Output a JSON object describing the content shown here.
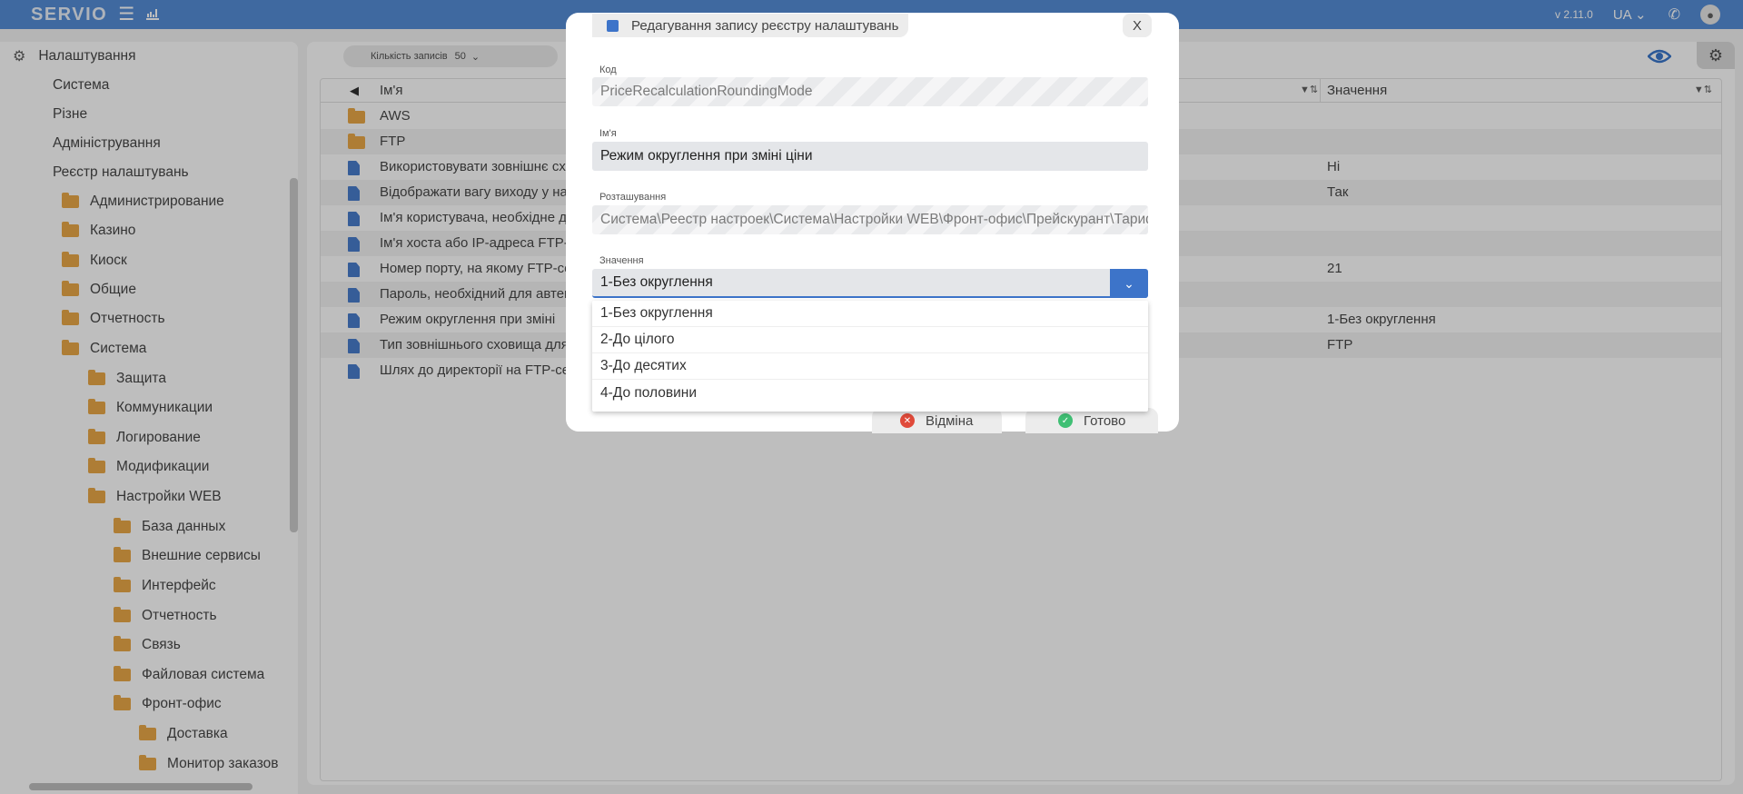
{
  "app": {
    "brand": "SERVIO",
    "version": "v 2.11.0",
    "language": "UA"
  },
  "sidebar": {
    "items": [
      {
        "label": "Налаштування",
        "icon": "gear-icon"
      },
      {
        "label": "Система"
      },
      {
        "label": "Різне"
      },
      {
        "label": "Адміністрування"
      },
      {
        "label": "Реєстр налаштувань"
      },
      {
        "label": "Администрирование",
        "icon": "folder-icon"
      },
      {
        "label": "Казино",
        "icon": "folder-icon"
      },
      {
        "label": "Киоск",
        "icon": "folder-icon"
      },
      {
        "label": "Общие",
        "icon": "folder-icon"
      },
      {
        "label": "Отчетность",
        "icon": "folder-icon"
      },
      {
        "label": "Система",
        "icon": "folder-icon"
      },
      {
        "label": "Защита",
        "icon": "folder-icon"
      },
      {
        "label": "Коммуникации",
        "icon": "folder-icon"
      },
      {
        "label": "Логирование",
        "icon": "folder-icon"
      },
      {
        "label": "Модификации",
        "icon": "folder-icon"
      },
      {
        "label": "Настройки WEB",
        "icon": "folder-icon"
      },
      {
        "label": "База данных",
        "icon": "folder-icon"
      },
      {
        "label": "Внешние сервисы",
        "icon": "folder-icon"
      },
      {
        "label": "Интерфейс",
        "icon": "folder-icon"
      },
      {
        "label": "Отчетность",
        "icon": "folder-icon"
      },
      {
        "label": "Связь",
        "icon": "folder-icon"
      },
      {
        "label": "Файловая система",
        "icon": "folder-icon"
      },
      {
        "label": "Фронт-офис",
        "icon": "folder-icon"
      },
      {
        "label": "Доставка",
        "icon": "folder-icon"
      },
      {
        "label": "Монитор заказов",
        "icon": "folder-icon"
      }
    ]
  },
  "toolbar": {
    "records_label": "Кількість записів",
    "records_value": "50"
  },
  "grid": {
    "columns": {
      "name": "Ім'я",
      "value": "Значення"
    },
    "rows": [
      {
        "name": "AWS",
        "value": "",
        "icon": "folder-icon"
      },
      {
        "name": "FTP",
        "value": "",
        "icon": "folder-icon"
      },
      {
        "name": "Використовувати зовнішнє сх",
        "value": "Ні",
        "icon": "document-icon"
      },
      {
        "name": "Відображати вагу виходу у на",
        "value": "Так",
        "icon": "document-icon"
      },
      {
        "name": "Ім'я користувача, необхідне д",
        "value": "",
        "icon": "document-icon"
      },
      {
        "name": "Ім'я хоста або IP-адреса FTP-с",
        "value": "",
        "icon": "document-icon"
      },
      {
        "name": "Номер порту, на якому FTP-се",
        "value": "21",
        "icon": "document-icon"
      },
      {
        "name": "Пароль, необхідний для автен",
        "value": "",
        "icon": "document-icon"
      },
      {
        "name": "Режим округлення при зміні",
        "value": "1-Без округлення",
        "icon": "document-icon"
      },
      {
        "name": "Тип зовнішнього сховища для",
        "value": "FTP",
        "icon": "document-icon"
      },
      {
        "name": "Шлях до директорії на FTP-се",
        "value": "",
        "icon": "document-icon"
      }
    ]
  },
  "modal": {
    "title": "Редагування запису реєстру налаштувань",
    "close_label": "X",
    "fields": {
      "code": {
        "label": "Код",
        "value": "PriceRecalculationRoundingMode"
      },
      "name": {
        "label": "Ім'я",
        "value": "Режим округлення при зміні ціни"
      },
      "location": {
        "label": "Розташування",
        "value": "Система\\Реестр настроек\\Система\\Настройки WEB\\Фронт-офис\\Прейскурант\\Тариф"
      },
      "value": {
        "label": "Значення",
        "value": "1-Без округлення"
      }
    },
    "options": [
      "1-Без округлення",
      "2-До цілого",
      "3-До десятих",
      "4-До половини"
    ],
    "cancel_label": "Відміна",
    "ok_label": "Готово"
  },
  "colors": {
    "accent": "#4a86d4",
    "primary": "#3d74c9",
    "folder": "#e9a33b",
    "cancel": "#e04a3a",
    "ok": "#3fbf74"
  }
}
